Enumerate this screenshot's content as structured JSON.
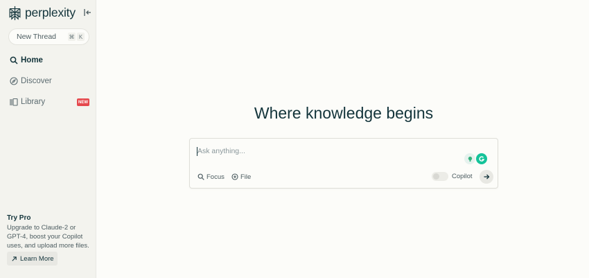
{
  "brand": {
    "name": "perplexity",
    "color": "#13343b"
  },
  "sidebar": {
    "new_thread": {
      "label": "New Thread",
      "shortcut": [
        "⌘",
        "K"
      ]
    },
    "nav": [
      {
        "label": "Home",
        "icon": "search-icon",
        "active": true
      },
      {
        "label": "Discover",
        "icon": "compass-icon",
        "active": false
      },
      {
        "label": "Library",
        "icon": "library-icon",
        "active": false,
        "badge": "NEW"
      }
    ],
    "promo": {
      "title": "Try Pro",
      "text": "Upgrade to Claude-2 or GPT-4, boost your Copilot uses, and upload more files.",
      "button": "Learn More"
    }
  },
  "main": {
    "headline": "Where knowledge begins",
    "ask": {
      "placeholder": "Ask anything...",
      "value": "",
      "focus_label": "Focus",
      "file_label": "File",
      "copilot_label": "Copilot",
      "copilot_on": false
    }
  },
  "colors": {
    "accent": "#13343b",
    "badge": "#e5484d",
    "background": "#fcfcf9",
    "sidebar": "#f3f3ee"
  }
}
